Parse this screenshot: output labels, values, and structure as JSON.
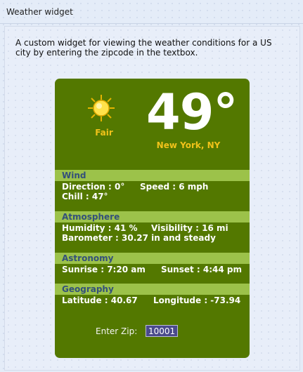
{
  "window": {
    "title": "Weather widget"
  },
  "description": "A custom widget for viewing the weather conditions for a US city by entering the zipcode in the textbox.",
  "weather": {
    "condition": "Fair",
    "condition_icon": "sun-icon",
    "temperature": "49°",
    "location": "New York, NY"
  },
  "sections": {
    "wind": {
      "title": "Wind",
      "direction": "Direction : 0°",
      "speed": "Speed : 6 mph",
      "chill": "Chill : 47°"
    },
    "atmosphere": {
      "title": "Atmosphere",
      "humidity": "Humidity : 41 %",
      "visibility": "Visibility : 16 mi",
      "barometer": "Barometer : 30.27 in and steady"
    },
    "astronomy": {
      "title": "Astronomy",
      "sunrise": "Sunrise : 7:20 am",
      "sunset": "Sunset : 4:44 pm"
    },
    "geography": {
      "title": "Geography",
      "latitude": "Latitude : 40.67",
      "longitude": "Longitude : -73.94"
    }
  },
  "zip": {
    "label": "Enter Zip:",
    "value": "10001"
  },
  "colors": {
    "widget_bg": "#537800",
    "section_header": "#9cc24a",
    "accent_yellow": "#f0c21a"
  }
}
